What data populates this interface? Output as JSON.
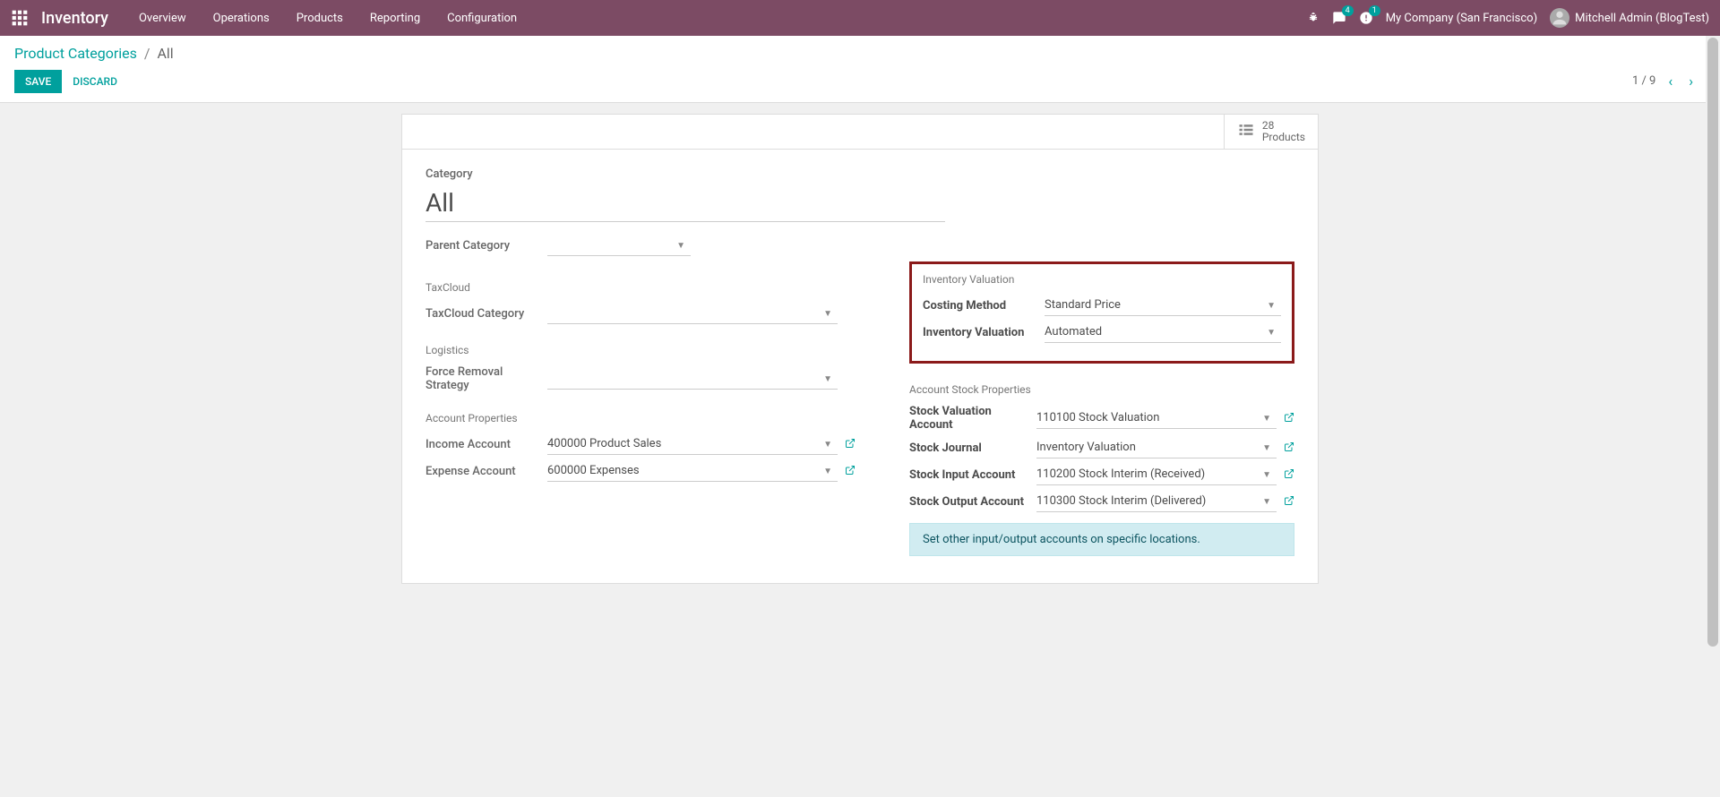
{
  "app": {
    "name": "Inventory"
  },
  "topnav": {
    "menu": [
      "Overview",
      "Operations",
      "Products",
      "Reporting",
      "Configuration"
    ],
    "company": "My Company (San Francisco)",
    "user": "Mitchell Admin (BlogTest)",
    "msg_badge": "4",
    "activity_badge": "1"
  },
  "breadcrumb": {
    "root": "Product Categories",
    "current": "All"
  },
  "actions": {
    "save": "SAVE",
    "discard": "DISCARD"
  },
  "pager": {
    "text": "1 / 9"
  },
  "stat": {
    "count": "28",
    "label": "Products"
  },
  "form": {
    "category_label": "Category",
    "category_value": "All",
    "parent_category_label": "Parent Category",
    "parent_category_value": "",
    "taxcloud_title": "TaxCloud",
    "taxcloud_category_label": "TaxCloud Category",
    "taxcloud_category_value": "",
    "logistics_title": "Logistics",
    "force_removal_label": "Force Removal Strategy",
    "force_removal_value": "",
    "inventory_valuation_title": "Inventory Valuation",
    "costing_method_label": "Costing Method",
    "costing_method_value": "Standard Price",
    "inv_valuation_label": "Inventory Valuation",
    "inv_valuation_value": "Automated",
    "account_props_title": "Account Properties",
    "income_account_label": "Income Account",
    "income_account_value": "400000 Product Sales",
    "expense_account_label": "Expense Account",
    "expense_account_value": "600000 Expenses",
    "account_stock_title": "Account Stock Properties",
    "stock_valuation_label": "Stock Valuation Account",
    "stock_valuation_value": "110100 Stock Valuation",
    "stock_journal_label": "Stock Journal",
    "stock_journal_value": "Inventory Valuation",
    "stock_input_label": "Stock Input Account",
    "stock_input_value": "110200 Stock Interim (Received)",
    "stock_output_label": "Stock Output Account",
    "stock_output_value": "110300 Stock Interim (Delivered)",
    "info_text": "Set other input/output accounts on specific locations."
  }
}
